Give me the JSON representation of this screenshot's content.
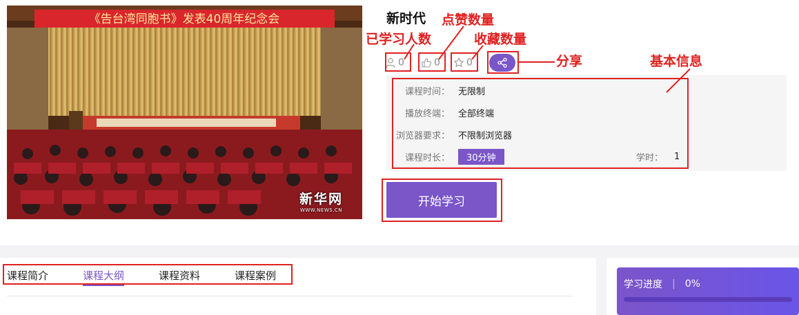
{
  "cover": {
    "banner_text": "《告台湾同胞书》发表40周年纪念会",
    "watermark_main": "新华网",
    "watermark_sub": "WWW.NEWS.CN"
  },
  "course": {
    "title": "新时代",
    "learners": "0",
    "likes": "0",
    "favorites": "0"
  },
  "info": {
    "time_label": "课程时间：",
    "time_value": "无限制",
    "terminal_label": "播放终端：",
    "terminal_value": "全部终端",
    "browser_label": "浏览器要求：",
    "browser_value": "不限制浏览器",
    "duration_label": "课程时长：",
    "duration_value": "30分钟",
    "hours_label": "学时：",
    "hours_value": "1"
  },
  "start_button": "开始学习",
  "tabs": [
    {
      "label": "课程简介",
      "active": false
    },
    {
      "label": "课程大纲",
      "active": true
    },
    {
      "label": "课程资料",
      "active": false
    },
    {
      "label": "课程案例",
      "active": false
    }
  ],
  "progress": {
    "label": "学习进度",
    "value": "0%",
    "fraction": 0
  },
  "annotations": {
    "learners": "已学习人数",
    "likes": "点赞数量",
    "favorites": "收藏数量",
    "share": "分享",
    "info": "基本信息"
  },
  "colors": {
    "accent": "#7a56c8",
    "annotation": "#e02020"
  },
  "icons": [
    "user-icon",
    "thumbs-up-icon",
    "star-icon",
    "share-icon"
  ]
}
